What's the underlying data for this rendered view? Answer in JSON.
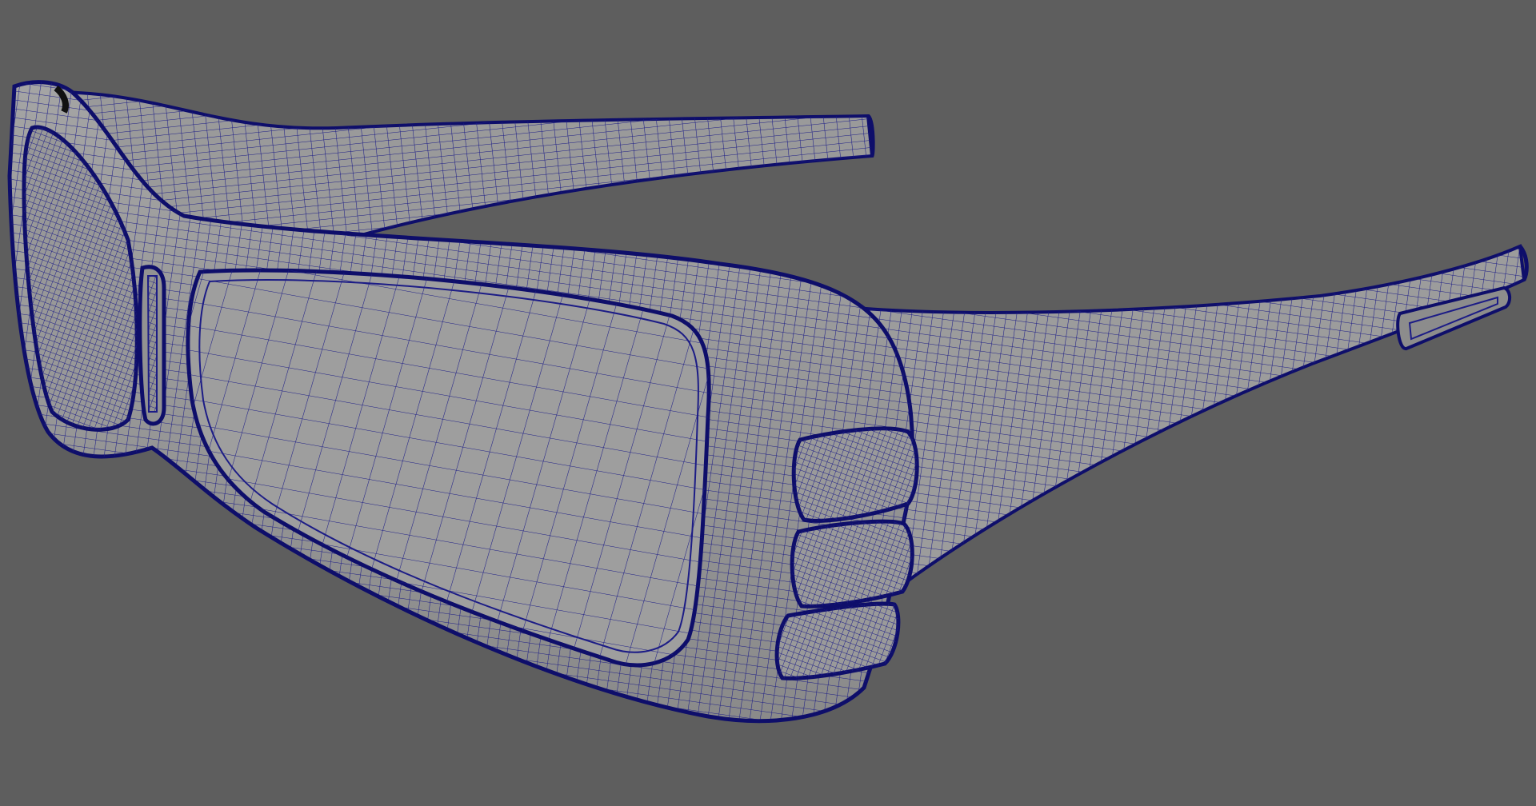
{
  "scene": {
    "background_color": "#5e5e5e",
    "mesh_fill_color": "#9c9c9c",
    "wire_color": "#1c1c86",
    "outline_color": "#0e0e6a",
    "shade_color": "#7a7a7a"
  }
}
